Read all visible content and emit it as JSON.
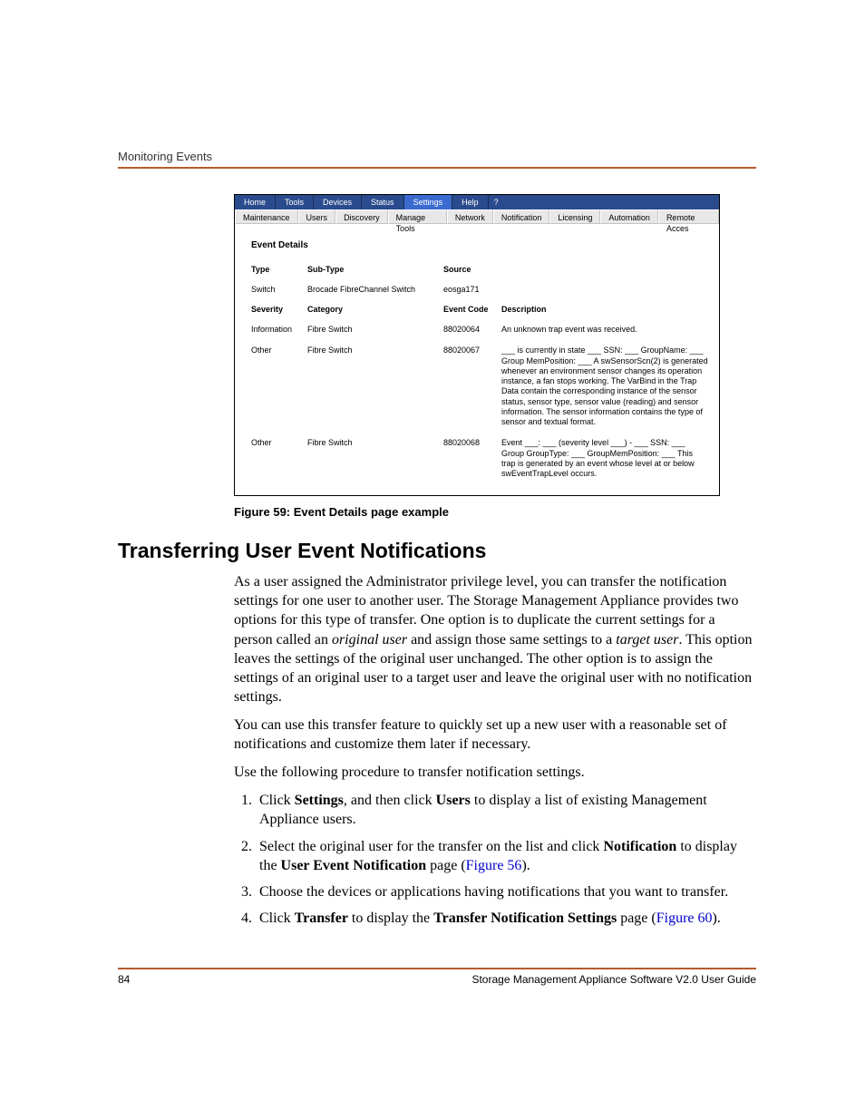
{
  "header": {
    "section": "Monitoring Events"
  },
  "screenshot": {
    "menubar": [
      "Home",
      "Tools",
      "Devices",
      "Status",
      "Settings",
      "Help"
    ],
    "menubar_active_index": 4,
    "help_icon": "?",
    "subbar": [
      "Maintenance",
      "Users",
      "Discovery",
      "Manage Tools",
      "Network",
      "Notification",
      "Licensing",
      "Automation",
      "Remote Acces"
    ],
    "panel_title": "Event Details",
    "headers_row1": {
      "c1": "Type",
      "c2": "Sub-Type",
      "c3": "Source",
      "c4": ""
    },
    "row1": {
      "c1": "Switch",
      "c2": "Brocade FibreChannel Switch",
      "c3": "eosga171",
      "c4": ""
    },
    "headers_row2": {
      "c1": "Severity",
      "c2": "Category",
      "c3": "Event Code",
      "c4": "Description"
    },
    "rows": [
      {
        "c1": "Information",
        "c2": "Fibre Switch",
        "c3": "88020064",
        "c4": "An unknown trap event was received."
      },
      {
        "c1": "Other",
        "c2": "Fibre Switch",
        "c3": "88020067",
        "c4": "___ is currently in state ___ SSN: ___ GroupName: ___ Group MemPosition: ___ A swSensorScn(2) is generated whenever an environment sensor changes its operation instance, a fan stops working. The VarBind in the Trap Data contain the corresponding instance of the sensor status, sensor type, sensor value (reading) and sensor information. The sensor information contains the type of sensor and textual format."
      },
      {
        "c1": "Other",
        "c2": "Fibre Switch",
        "c3": "88020068",
        "c4": "Event ___: ___ (severity level ___) - ___ SSN: ___ Group GroupType: ___ GroupMemPosition: ___ This trap is generated by an event whose level at or below swEventTrapLevel occurs."
      }
    ]
  },
  "caption": "Figure 59:  Event Details page example",
  "section_heading": "Transferring User Event Notifications",
  "p1_a": "As a user assigned the Administrator privilege level, you can transfer the notification settings for one user to another user. The Storage Management Appliance provides two options for this type of transfer. One option is to duplicate the current settings for a person called an ",
  "p1_i1": "original user",
  "p1_b": " and assign those same settings to a ",
  "p1_i2": "target user",
  "p1_c": ". This option leaves the settings of the original user unchanged. The other option is to assign the settings of an original user to a target user and leave the original user with no notification settings.",
  "p2": "You can use this transfer feature to quickly set up a new user with a reasonable set of notifications and customize them later if necessary.",
  "p3": "Use the following procedure to transfer notification settings.",
  "steps": {
    "s1_a": "Click ",
    "s1_b1": "Settings",
    "s1_b": ", and then click ",
    "s1_b2": "Users",
    "s1_c": " to display a list of existing Management Appliance users.",
    "s2_a": "Select the original user for the transfer on the list and click ",
    "s2_b1": "Notification",
    "s2_b": " to display the ",
    "s2_b2": "User Event Notification",
    "s2_c": " page (",
    "s2_link": "Figure 56",
    "s2_d": ").",
    "s3": "Choose the devices or applications having notifications that you want to transfer.",
    "s4_a": "Click ",
    "s4_b1": "Transfer",
    "s4_b": " to display the ",
    "s4_b2": "Transfer Notification Settings",
    "s4_c": " page (",
    "s4_link": "Figure 60",
    "s4_d": ")."
  },
  "footer": {
    "page": "84",
    "title": "Storage Management Appliance Software V2.0 User Guide"
  }
}
